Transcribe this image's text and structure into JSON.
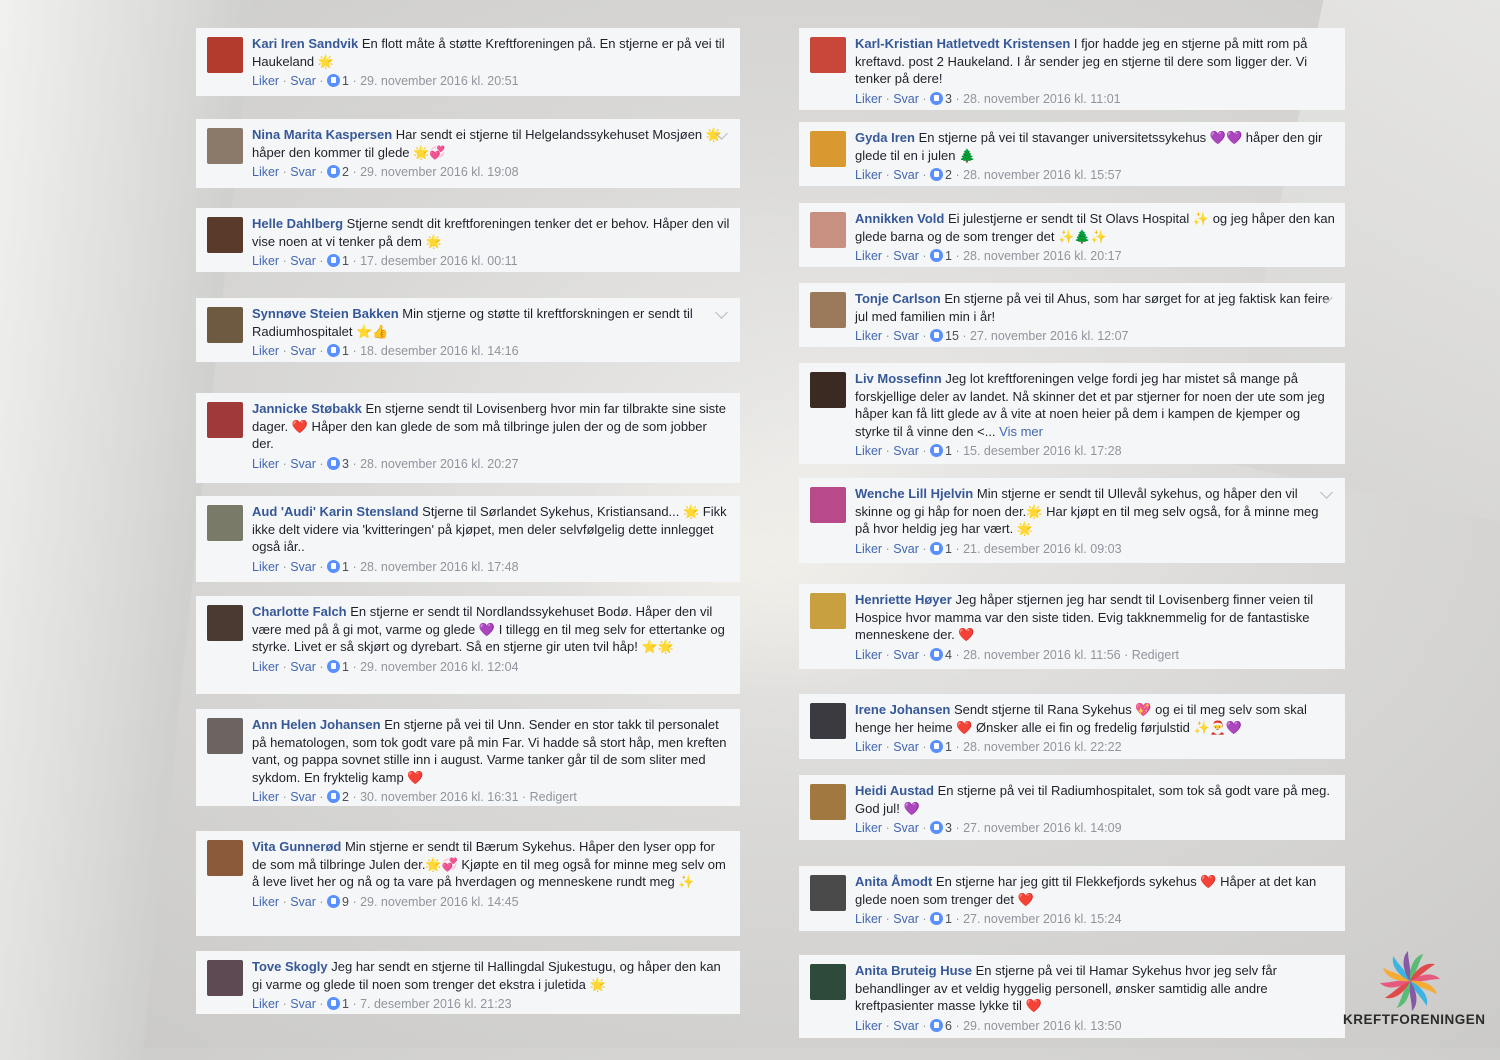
{
  "common": {
    "like": "Liker",
    "reply": "Svar",
    "sep": " · "
  },
  "left": [
    {
      "name": "Kari Iren Sandvik",
      "text": "En flott måte å støtte Kreftforeningen på. En stjerne er på vei til Haukeland",
      "emoji": "🌟",
      "likes": "1",
      "date": "29. november 2016 kl. 20:51",
      "edited": "",
      "avatar": "#b23b2e"
    },
    {
      "name": "Nina Marita Kaspersen",
      "text": "Har sendt ei stjerne til Helgelandssykehuset Mosjøen",
      "emoji": "🌟håper den kommer til glede 🌟💞",
      "likes": "2",
      "date": "29. november 2016 kl. 19:08",
      "edited": "",
      "avatar": "#8b7a6a"
    },
    {
      "name": "Helle Dahlberg",
      "text": "Stjerne sendt dit kreftforeningen tenker det er behov. Håper den vil vise noen at vi tenker på dem",
      "emoji": "🌟",
      "likes": "1",
      "date": "17. desember 2016 kl. 00:11",
      "edited": "",
      "avatar": "#5a3a2a"
    },
    {
      "name": "Synnøve Steien Bakken",
      "text": "Min stjerne og støtte til kreftforskningen er sendt til Radiumhospitalet",
      "emoji": "⭐👍",
      "likes": "1",
      "date": "18. desember 2016 kl. 14:16",
      "edited": "",
      "avatar": "#6e5a40"
    },
    {
      "name": "Jannicke Støbakk",
      "text": "En stjerne sendt til Lovisenberg hvor min far tilbrakte sine siste dager. ❤️ Håper den kan glede de som må tilbringe julen der og de som jobber der.",
      "emoji": "",
      "likes": "3",
      "date": "28. november 2016 kl. 20:27",
      "edited": "",
      "avatar": "#a03a3a"
    },
    {
      "name": "Aud 'Audi' Karin Stensland",
      "text": "Stjerne til Sørlandet Sykehus, Kristiansand... 🌟 Fikk ikke delt videre via 'kvitteringen' på kjøpet, men deler selvfølgelig dette innlegget også iår..",
      "emoji": "",
      "likes": "1",
      "date": "28. november 2016 kl. 17:48",
      "edited": "",
      "avatar": "#7a7a68"
    },
    {
      "name": "Charlotte Falch",
      "text": "En stjerne er sendt til Nordlandssykehuset Bodø. Håper den vil være med på å gi mot, varme og glede 💜 I tillegg en til meg selv for ettertanke og styrke. Livet er så skjørt og dyrebart. Så en stjerne gir uten tvil håp!",
      "emoji": "⭐🌟",
      "likes": "1",
      "date": "29. november 2016 kl. 12:04",
      "edited": "",
      "avatar": "#4a3a32"
    },
    {
      "name": "Ann Helen Johansen",
      "text": "En stjerne på vei til Unn. Sender en stor takk til personalet på hematologen, som tok godt vare på min Far. Vi hadde så stort håp, men kreften vant, og pappa sovnet stille inn i august. Varme tanker går til de som sliter med sykdom. En fryktelig kamp",
      "emoji": "❤️",
      "likes": "2",
      "date": "30. november 2016 kl. 16:31",
      "edited": "Redigert",
      "avatar": "#6b6460"
    },
    {
      "name": "Vita Gunnerød",
      "text": "Min stjerne er sendt til Bærum Sykehus. Håper den lyser opp for de som må tilbringe Julen der.🌟💞 Kjøpte en til meg også for minne meg selv om å leve livet her og nå og ta vare på hverdagen og menneskene rundt meg",
      "emoji": "✨",
      "likes": "9",
      "date": "29. november 2016 kl. 14:45",
      "edited": "",
      "avatar": "#8a5a3a"
    },
    {
      "name": "Tove Skogly",
      "text": "Jeg har sendt en stjerne til Hallingdal Sjukestugu, og håper den kan gi varme og glede til noen som trenger det ekstra i juletida",
      "emoji": "🌟",
      "likes": "1",
      "date": "7. desember 2016 kl. 21:23",
      "edited": "",
      "avatar": "#5e4a52"
    }
  ],
  "right": [
    {
      "name": "Karl-Kristian Hatletvedt Kristensen",
      "text": "I fjor hadde jeg en stjerne på mitt rom på kreftavd. post 2 Haukeland. I år sender jeg en stjerne til dere som ligger der. Vi tenker på dere!",
      "emoji": "",
      "likes": "3",
      "date": "28. november 2016 kl. 11:01",
      "edited": "",
      "avatar": "#c8473a"
    },
    {
      "name": "Gyda Iren",
      "text": "En stjerne på vei til stavanger universitetssykehus 💜💜 håper den gir glede til en i julen",
      "emoji": "🌲",
      "likes": "2",
      "date": "28. november 2016 kl. 15:57",
      "edited": "",
      "avatar": "#d89a30"
    },
    {
      "name": "Annikken Vold",
      "text": "Ei julestjerne er sendt til St Olavs Hospital ✨ og jeg håper den kan glede barna og de som trenger det",
      "emoji": "✨🌲✨",
      "likes": "1",
      "date": "28. november 2016 kl. 20:17",
      "edited": "",
      "avatar": "#c89080"
    },
    {
      "name": "Tonje Carlson",
      "text": "En stjerne på vei til Ahus, som har sørget for at jeg faktisk kan feire jul med familien min i år!",
      "emoji": "",
      "likes": "15",
      "date": "27. november 2016 kl. 12:07",
      "edited": "",
      "avatar": "#9a7a5a"
    },
    {
      "name": "Liv Mossefinn",
      "text": "Jeg lot kreftforeningen velge fordi jeg har mistet så mange på forskjellige deler av landet. Nå skinner det et par stjerner for noen der ute som jeg håper kan få litt glede av å vite at noen heier på dem i kampen de kjemper og styrke til å vinne den <...",
      "more": "Vis mer",
      "emoji": "",
      "likes": "1",
      "date": "15. desember 2016 kl. 17:28",
      "edited": "",
      "avatar": "#3a2a22"
    },
    {
      "name": "Wenche Lill Hjelvin",
      "text": "Min stjerne er sendt til Ullevål sykehus, og håper den vil skinne og gi håp for noen der.🌟 Har kjøpt en til meg selv også, for å minne meg på hvor heldig jeg har vært.",
      "emoji": "🌟",
      "likes": "1",
      "date": "21. desember 2016 kl. 09:03",
      "edited": "",
      "avatar": "#b84a8a"
    },
    {
      "name": "Henriette Høyer",
      "text": "Jeg håper stjernen jeg har sendt til Lovisenberg finner veien til Hospice hvor mamma var den siste tiden. Evig takknemmelig for de fantastiske menneskene der.",
      "emoji": "❤️",
      "likes": "4",
      "date": "28. november 2016 kl. 11:56",
      "edited": "Redigert",
      "avatar": "#c8a040"
    },
    {
      "name": "Irene Johansen",
      "text": "Sendt stjerne til Rana Sykehus 💖 og ei til meg selv som skal henge her heime ❤️ Ønsker alle ei fin og fredelig førjulstid",
      "emoji": "✨🎅💜",
      "likes": "1",
      "date": "28. november 2016 kl. 22:22",
      "edited": "",
      "avatar": "#3a3a40"
    },
    {
      "name": "Heidi Austad",
      "text": "En stjerne på vei til Radiumhospitalet, som tok så godt vare på meg. God jul!",
      "emoji": "💜",
      "likes": "3",
      "date": "27. november 2016 kl. 14:09",
      "edited": "",
      "avatar": "#a07840"
    },
    {
      "name": "Anita Åmodt",
      "text": "En stjerne har jeg gitt til Flekkefjords sykehus ❤️ Håper at det kan glede noen som trenger det",
      "emoji": "❤️",
      "likes": "1",
      "date": "27. november 2016 kl. 15:24",
      "edited": "",
      "avatar": "#4a4a4a"
    },
    {
      "name": "Anita Bruteig Huse",
      "text": "En stjerne på vei til Hamar Sykehus hvor jeg selv får behandlinger av et veldig hyggelig personell, ønsker samtidig alle andre kreftpasienter masse lykke til",
      "emoji": "❤️",
      "likes": "6",
      "date": "29. november 2016 kl. 13:50",
      "edited": "",
      "avatar": "#2e4a3a"
    }
  ],
  "logo": {
    "text": "KREFTFORENINGEN",
    "colors": [
      "#e94e77",
      "#f7a823",
      "#2cb0e4",
      "#7c4ea0",
      "#4cba6a",
      "#e23c3c"
    ]
  }
}
